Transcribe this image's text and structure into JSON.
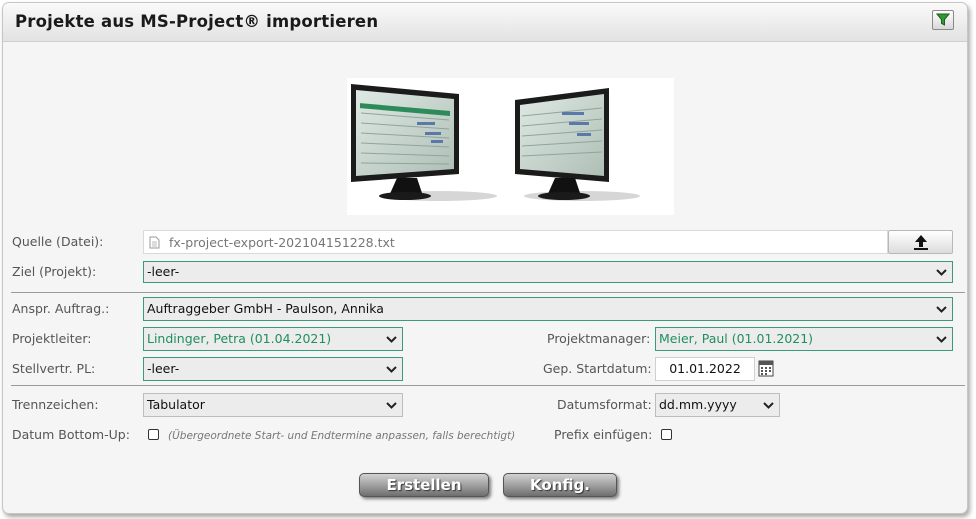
{
  "dialog": {
    "title": "Projekte aus MS-Project® importieren"
  },
  "icons": {
    "filter": "filter-icon",
    "upload": "upload-icon",
    "calendar": "calendar-icon",
    "file": "file-icon",
    "dropdown": "chevron-down-icon"
  },
  "colors": {
    "green_value": "#1f8f5f",
    "green_border": "#3a9a7c",
    "button": "#8e8e8e"
  },
  "form": {
    "source": {
      "label": "Quelle (Datei):",
      "filename": "fx-project-export-202104151228.txt"
    },
    "target": {
      "label": "Ziel (Projekt):",
      "value": "-leer-"
    },
    "client": {
      "label": "Anspr. Auftrag.:",
      "value": "Auftraggeber GmbH - Paulson, Annika"
    },
    "project_lead": {
      "label": "Projektleiter:",
      "value": "Lindinger, Petra (01.04.2021)"
    },
    "project_manager": {
      "label": "Projektmanager:",
      "value": "Meier, Paul (01.01.2021)"
    },
    "deputy_lead": {
      "label": "Stellvertr. PL:",
      "value": "-leer-"
    },
    "planned_start": {
      "label": "Gep. Startdatum:",
      "value": "01.01.2022"
    },
    "separator": {
      "label": "Trennzeichen:",
      "value": "Tabulator"
    },
    "date_format": {
      "label": "Datumsformat:",
      "value": "dd.mm.yyyy"
    },
    "date_bottom_up": {
      "label": "Datum Bottom-Up:",
      "checked": false,
      "hint": "(Übergeordnete Start- und Endtermine anpassen, falls berechtigt)"
    },
    "add_prefix": {
      "label": "Prefix einfügen:",
      "checked": false
    }
  },
  "buttons": {
    "create": "Erstellen",
    "config": "Konfig."
  }
}
